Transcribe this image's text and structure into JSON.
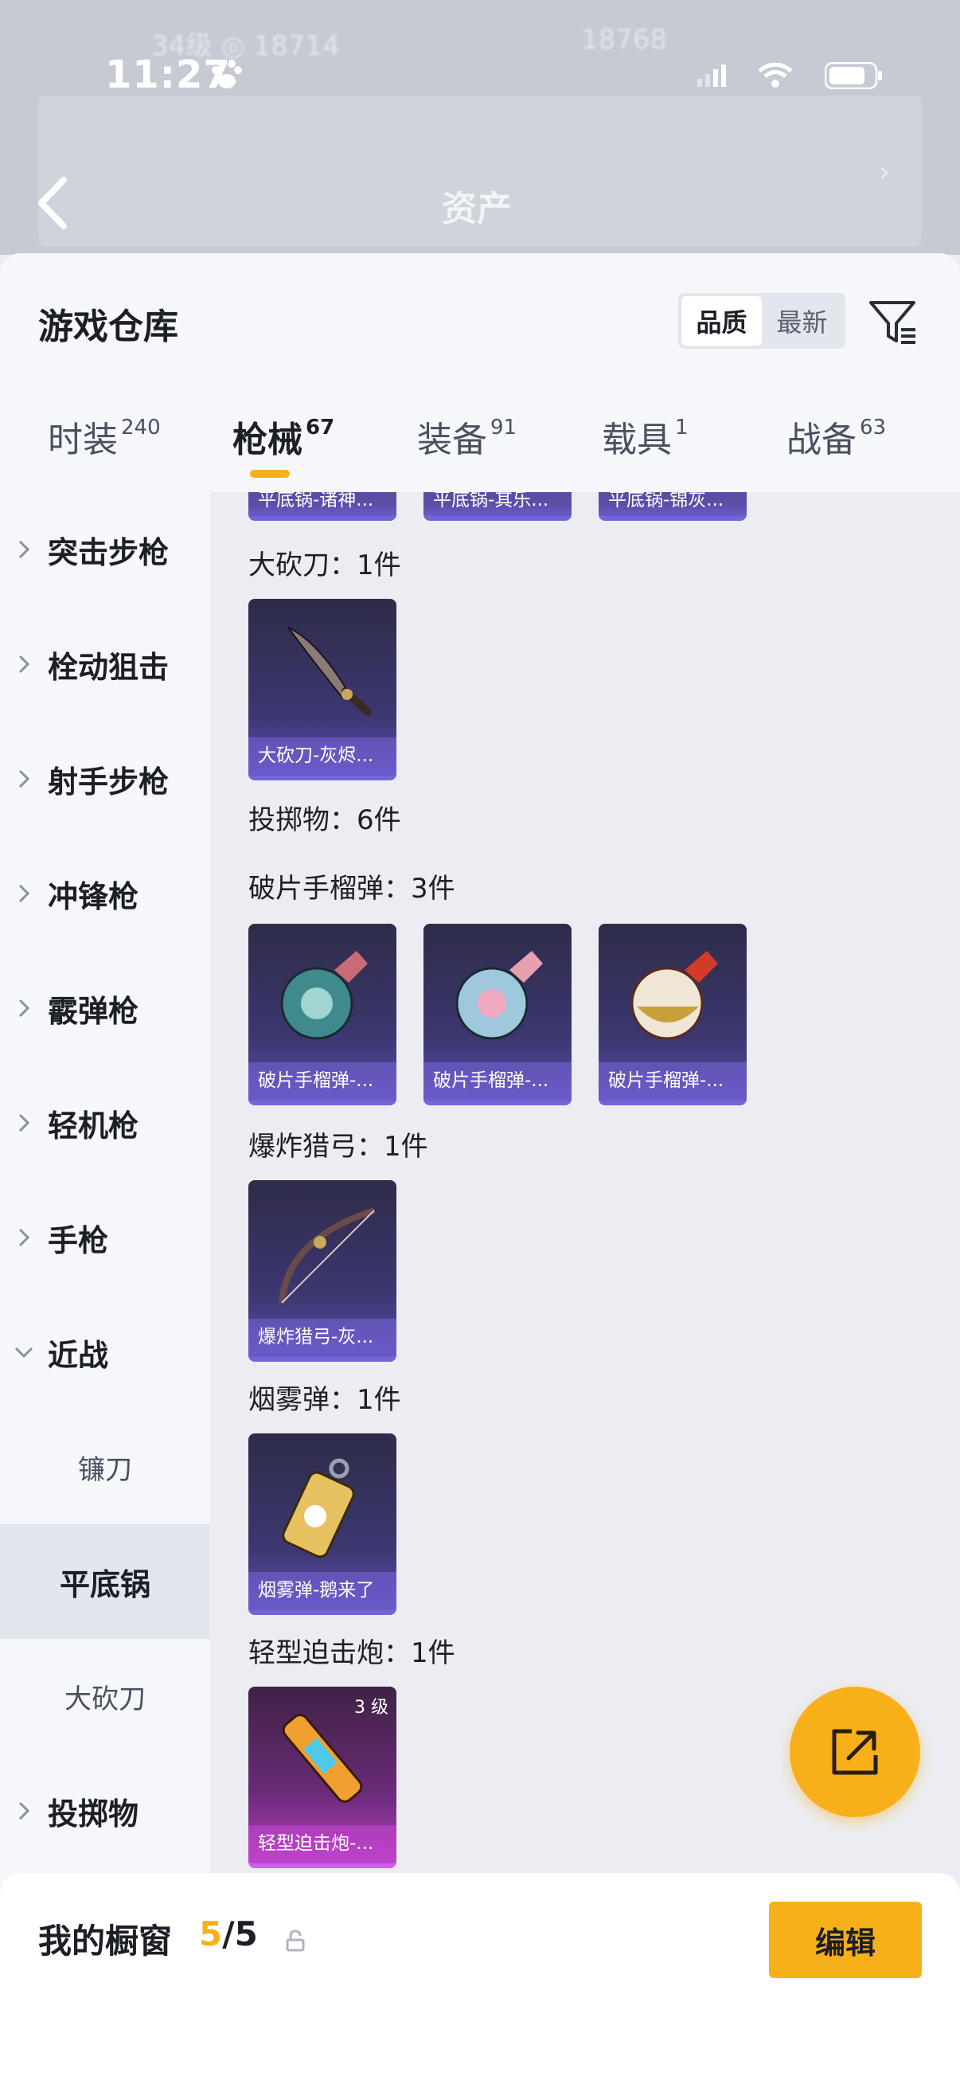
{
  "status_bar": {
    "time": "11:27"
  },
  "background": {
    "title": "资产"
  },
  "header": {
    "title": "游戏仓库",
    "sort_options": [
      "品质",
      "最新"
    ],
    "sort_active": "品质"
  },
  "tabs": [
    {
      "label": "时装",
      "count": "240"
    },
    {
      "label": "枪械",
      "count": "67"
    },
    {
      "label": "装备",
      "count": "91"
    },
    {
      "label": "载具",
      "count": "1"
    },
    {
      "label": "战备",
      "count": "63"
    }
  ],
  "sidebar": {
    "items": [
      {
        "label": "突击步枪",
        "expanded": false
      },
      {
        "label": "栓动狙击",
        "expanded": false
      },
      {
        "label": "射手步枪",
        "expanded": false
      },
      {
        "label": "冲锋枪",
        "expanded": false
      },
      {
        "label": "霰弹枪",
        "expanded": false
      },
      {
        "label": "轻机枪",
        "expanded": false
      },
      {
        "label": "手枪",
        "expanded": false
      },
      {
        "label": "近战",
        "expanded": true
      }
    ],
    "sub_items": [
      {
        "label": "镰刀",
        "active": false
      },
      {
        "label": "平底锅",
        "active": true
      },
      {
        "label": "大砍刀",
        "active": false
      }
    ],
    "after_items": [
      {
        "label": "投掷物",
        "expanded": false
      }
    ]
  },
  "content": {
    "top_cards": [
      "平底锅-诸神...",
      "平底锅-其乐...",
      "平底锅-锦灰..."
    ],
    "sections": [
      {
        "label": "大砍刀：1件",
        "cards": [
          {
            "name": "大砍刀-灰烬...",
            "icon": "machete-icon"
          }
        ]
      },
      {
        "label": "投掷物：6件",
        "cards": []
      },
      {
        "label": "破片手榴弹：3件",
        "cards": [
          {
            "name": "破片手榴弹-...",
            "icon": "grenade-icon"
          },
          {
            "name": "破片手榴弹-...",
            "icon": "grenade-icon"
          },
          {
            "name": "破片手榴弹-...",
            "icon": "grenade-icon"
          }
        ]
      },
      {
        "label": "爆炸猎弓：1件",
        "cards": [
          {
            "name": "爆炸猎弓-灰...",
            "icon": "bow-icon"
          }
        ]
      },
      {
        "label": "烟雾弹：1件",
        "cards": [
          {
            "name": "烟雾弹-鹅来了",
            "icon": "smoke-grenade-icon"
          }
        ]
      },
      {
        "label": "轻型迫击炮：1件",
        "cards": [
          {
            "name": "轻型迫击炮-...",
            "icon": "mortar-icon",
            "level": "3 级"
          }
        ]
      }
    ]
  },
  "showcase": {
    "label": "我的橱窗",
    "current": "5",
    "total": "/5",
    "edit_label": "编辑"
  },
  "colors": {
    "accent": "#f8b01a",
    "card_purple": "#3c3770",
    "card_pink": "#b13fc4"
  }
}
